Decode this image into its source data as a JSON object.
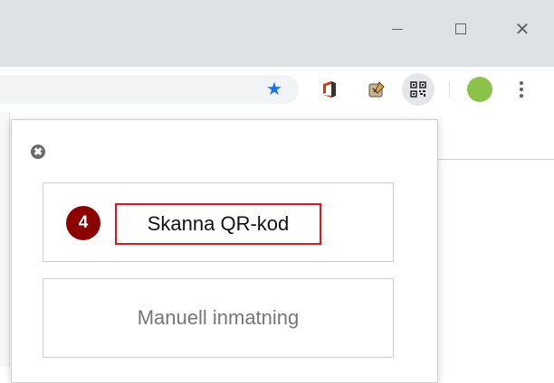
{
  "window_controls": {
    "minimize_icon": "minimize-icon",
    "maximize_icon": "maximize-icon",
    "close_icon": "close-icon",
    "close_glyph": "✕"
  },
  "toolbar": {
    "bookmark_star": "★",
    "extensions": [
      "office-icon",
      "clipboard-tool-icon",
      "qr-code-icon",
      "profile-icon"
    ],
    "menu_icon": "more-vert-icon"
  },
  "popup": {
    "close_glyph": "✖",
    "step_number": "4",
    "scan_button_label": "Skanna QR-kod",
    "manual_button_label": "Manuell inmatning",
    "highlight_color": "#e3141b",
    "badge_color": "#8b0000"
  }
}
